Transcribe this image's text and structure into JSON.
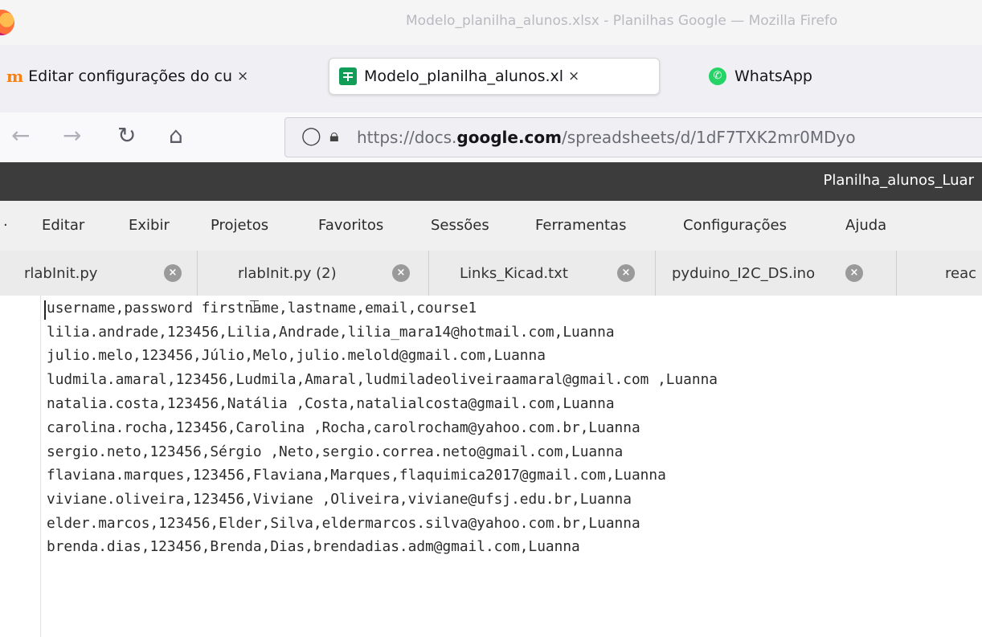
{
  "firefox": {
    "window_title": "Modelo_planilha_alunos.xlsx - Planilhas Google — Mozilla Firefo",
    "tabs": [
      {
        "label": "Editar configurações do cu",
        "close": "×",
        "icon": "moodle-icon"
      },
      {
        "label": "Modelo_planilha_alunos.xl",
        "close": "×",
        "icon": "sheets-icon"
      },
      {
        "label": "WhatsApp",
        "icon": "whatsapp-icon"
      }
    ],
    "url_scheme": "https://docs.",
    "url_host": "google.com",
    "url_path": "/spreadsheets/d/1dF7TXK2mr0MDyo"
  },
  "editor": {
    "title": "Planilha_alunos_Luar",
    "menu": [
      "Editar",
      "Exibir",
      "Projetos",
      "Favoritos",
      "Sessões",
      "Ferramentas",
      "Configurações",
      "Ajuda"
    ],
    "doc_tabs": [
      "rlabInit.py",
      "rlabInit.py (2)",
      "Links_Kicad.txt",
      "pyduino_I2C_DS.ino",
      "reac"
    ],
    "lines": [
      "username,password firstname,lastname,email,course1",
      "lilia.andrade,123456,Lilia,Andrade,lilia_mara14@hotmail.com,Luanna",
      "julio.melo,123456,Júlio,Melo,julio.melold@gmail.com,Luanna",
      "ludmila.amaral,123456,Ludmila,Amaral,ludmiladeoliveiraamaral@gmail.com ,Luanna",
      "natalia.costa,123456,Natália ,Costa,natalialcosta@gmail.com,Luanna",
      "carolina.rocha,123456,Carolina ,Rocha,carolrocham@yahoo.com.br,Luanna",
      "sergio.neto,123456,Sérgio ,Neto,sergio.correa.neto@gmail.com,Luanna",
      "flaviana.marques,123456,Flaviana,Marques,flaquimica2017@gmail.com,Luanna",
      "viviane.oliveira,123456,Viviane ,Oliveira,viviane@ufsj.edu.br,Luanna",
      "elder.marcos,123456,Elder,Silva,eldermarcos.silva@yahoo.com.br,Luanna",
      "brenda.dias,123456,Brenda,Dias,brendadias.adm@gmail.com,Luanna"
    ]
  }
}
